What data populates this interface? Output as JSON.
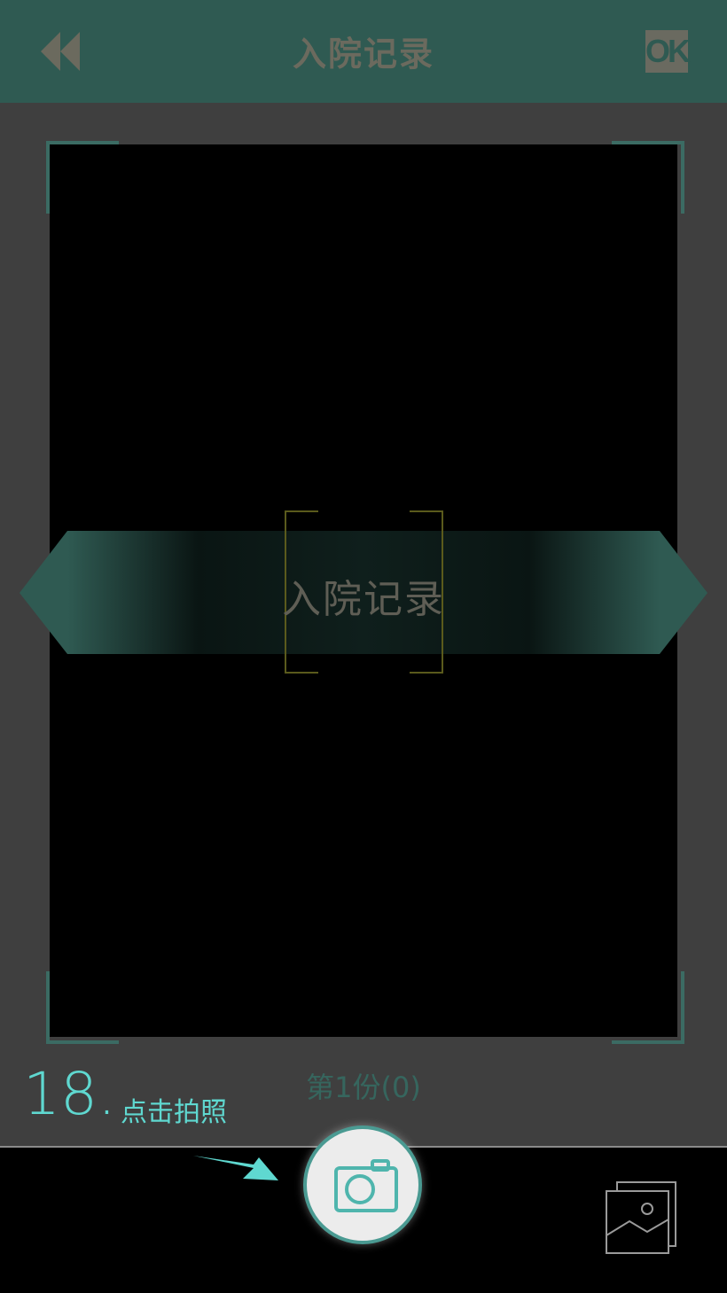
{
  "header": {
    "title": "入院记录",
    "back_icon": "rewind-icon",
    "ok_label": "OK"
  },
  "viewfinder": {
    "banner_label": "入院记录",
    "page_counter": "第1份(0)"
  },
  "annotation": {
    "step_number": "18.",
    "step_text": "点击拍照"
  },
  "bottom": {
    "capture_icon": "camera-icon",
    "gallery_icon": "gallery-icon"
  },
  "colors": {
    "header_bg": "#2f5a52",
    "accent": "#5fd8d0",
    "frame": "#3b6b63"
  }
}
